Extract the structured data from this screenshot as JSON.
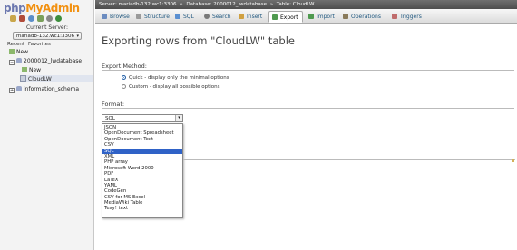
{
  "sidebar": {
    "logo": {
      "part1": "php",
      "part2": "MyAdmin"
    },
    "quick_icons": [
      "home-icon",
      "logout-icon",
      "help-icon",
      "docs-icon",
      "settings-icon",
      "reload-icon"
    ],
    "server_label": "Current Server:",
    "server_value": "mariadb-132.wc1:3306",
    "recent_tabs": [
      "Recent",
      "Favorites"
    ],
    "tree": {
      "new_top": "New",
      "db": "2000012_lwdatabase",
      "new_sub": "New",
      "table": "CloudLW",
      "info_schema": "information_schema"
    }
  },
  "breadcrumb": {
    "server": "Server: mariadb-132.wc1:3306",
    "database": "Database: 2000012_lwdatabase",
    "table": "Table: CloudLW",
    "sep": "»"
  },
  "tabs": [
    {
      "label": "Browse"
    },
    {
      "label": "Structure"
    },
    {
      "label": "SQL"
    },
    {
      "label": "Search"
    },
    {
      "label": "Insert"
    },
    {
      "label": "Export"
    },
    {
      "label": "Import"
    },
    {
      "label": "Operations"
    },
    {
      "label": "Triggers"
    }
  ],
  "main": {
    "title": "Exporting rows from \"CloudLW\" table",
    "export_method": {
      "label": "Export Method:",
      "quick": "Quick - display only the minimal options",
      "custom": "Custom - display all possible options"
    },
    "format": {
      "label": "Format:",
      "selected": "SQL",
      "options": [
        "JSON",
        "OpenDocument Spreadsheet",
        "OpenDocument Text",
        "CSV",
        "SQL",
        "XML",
        "PHP array",
        "Microsoft Word 2000",
        "PDF",
        "LaTeX",
        "YAML",
        "CodeGen",
        "CSV for MS Excel",
        "MediaWiki Table",
        "Texy! text"
      ]
    }
  },
  "colors": {
    "accent": "#2f62c7",
    "link": "#235a81",
    "topbar": "#5a5a5a"
  }
}
